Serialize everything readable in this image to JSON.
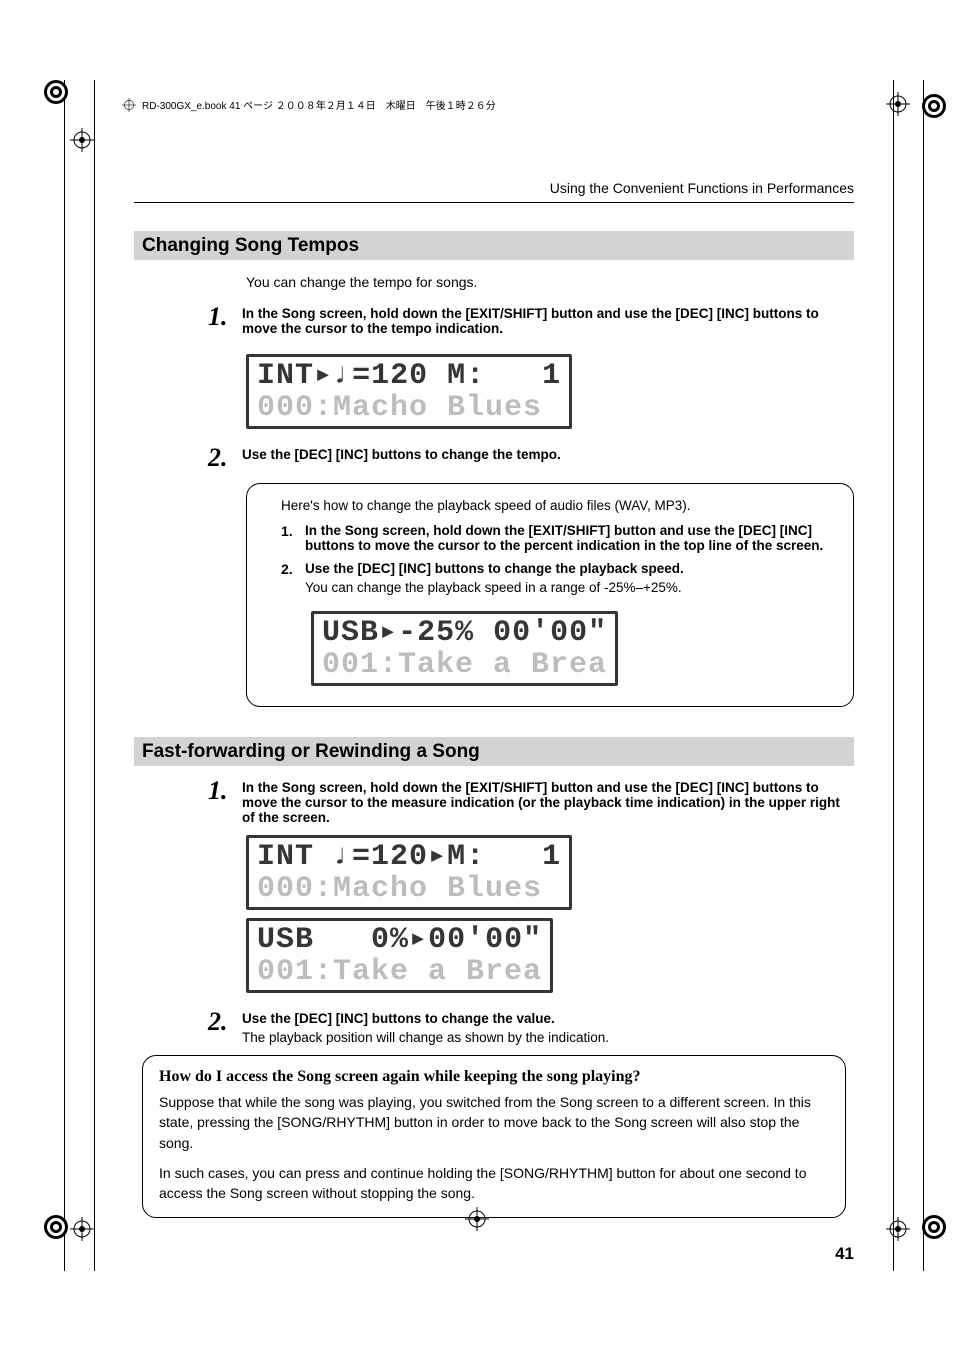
{
  "header_stamp": "RD-300GX_e.book 41 ページ ２００８年２月１４日　木曜日　午後１時２６分",
  "running_head": "Using the Convenient Functions in Performances",
  "section1": {
    "title": "Changing Song Tempos",
    "intro": "You can change the tempo for songs.",
    "step1": "In the Song screen, hold down the [EXIT/SHIFT] button and use the [DEC] [INC] buttons to move the cursor to the tempo indication.",
    "lcd1_line1": "INT▸♩=120 M:   1",
    "lcd1_line2": "000:Macho Blues",
    "step2": "Use the [DEC] [INC] buttons to change the tempo.",
    "note_intro": "Here's how to change the playback speed of audio files (WAV, MP3).",
    "note_step1": "In the Song screen, hold down the [EXIT/SHIFT] button and use the [DEC] [INC] buttons to move the cursor to the percent indication in the top line of the screen.",
    "note_step2": "Use the [DEC] [INC] buttons to change the playback speed.",
    "note_step2_follow": "You can change the playback speed in a range of -25%–+25%.",
    "lcd2_line1": "USB▸-25% 00'00\"",
    "lcd2_line2": "001:Take a Brea"
  },
  "section2": {
    "title": "Fast-forwarding or Rewinding a Song",
    "step1": "In the Song screen, hold down the [EXIT/SHIFT] button and use the [DEC] [INC] buttons to move the cursor to the measure indication (or the playback time indication) in the upper right of the screen.",
    "lcd3_line1": "INT ♩=120▸M:   1",
    "lcd3_line2": "000:Macho Blues",
    "lcd4_line1": "USB   0%▸00'00\"",
    "lcd4_line2": "001:Take a Brea",
    "step2": "Use the [DEC] [INC] buttons to change the value.",
    "step2_follow": "The playback position will change as shown by the indication."
  },
  "tip": {
    "title": "How do I access the Song screen again while keeping the song playing?",
    "p1": "Suppose that while the song was playing, you switched from the Song screen to a different screen. In this state, pressing the [SONG/RHYTHM] button in order to move back to the Song screen will also stop the song.",
    "p2": "In such cases, you can press and continue holding the [SONG/RHYTHM] button for about one second to access the Song screen without stopping the song."
  },
  "page_number": "41"
}
